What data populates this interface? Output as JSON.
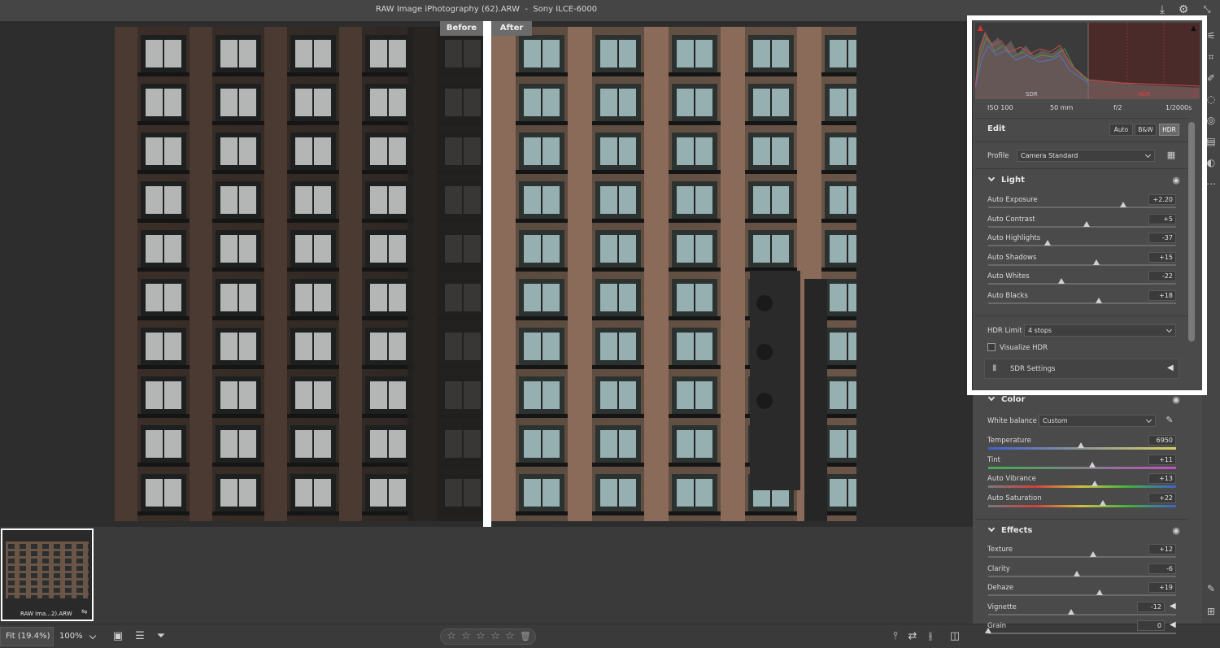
{
  "window": {
    "title": "RAW Image iPhotography (62).ARW  -  Sony ILCE-6000"
  },
  "canvas": {
    "before_label": "Before",
    "after_label": "After"
  },
  "filmstrip": {
    "thumb_label": "RAW Ima...2).ARW"
  },
  "bottom": {
    "fit_label": "Fit (19.4%)",
    "zoom_label": "100%",
    "rating_stars": 0
  },
  "histogram": {
    "sdr_label": "SDR",
    "hdr_label": "HDR"
  },
  "exif": {
    "iso": "ISO 100",
    "focal": "50 mm",
    "aperture": "f/2",
    "shutter": "1/2000s"
  },
  "edit": {
    "title": "Edit",
    "auto_btn": "Auto",
    "bw_btn": "B&W",
    "hdr_btn": "HDR",
    "profile_label": "Profile",
    "profile_value": "Camera Standard"
  },
  "light": {
    "title": "Light",
    "sliders": [
      {
        "label": "Auto Exposure",
        "value": "+2.20",
        "pos": 0.72
      },
      {
        "label": "Auto Contrast",
        "value": "+5",
        "pos": 0.525
      },
      {
        "label": "Auto Highlights",
        "value": "-37",
        "pos": 0.315
      },
      {
        "label": "Auto Shadows",
        "value": "+15",
        "pos": 0.575
      },
      {
        "label": "Auto Whites",
        "value": "-22",
        "pos": 0.39
      },
      {
        "label": "Auto Blacks",
        "value": "+18",
        "pos": 0.59
      }
    ],
    "hdr_limit_label": "HDR Limit",
    "hdr_limit_value": "4 stops",
    "visualize_hdr_label": "Visualize HDR",
    "sdr_settings_label": "SDR Settings"
  },
  "color": {
    "title": "Color",
    "wb_label": "White balance",
    "wb_value": "Custom",
    "sliders": [
      {
        "label": "Temperature",
        "value": "6950",
        "pos": 0.495
      },
      {
        "label": "Tint",
        "value": "+11",
        "pos": 0.555
      },
      {
        "label": "Auto Vibrance",
        "value": "+13",
        "pos": 0.565
      },
      {
        "label": "Auto Saturation",
        "value": "+22",
        "pos": 0.61
      }
    ]
  },
  "effects": {
    "title": "Effects",
    "sliders": [
      {
        "label": "Texture",
        "value": "+12",
        "pos": 0.56
      },
      {
        "label": "Clarity",
        "value": "-6",
        "pos": 0.47
      },
      {
        "label": "Dehaze",
        "value": "+19",
        "pos": 0.595
      },
      {
        "label": "Vignette",
        "value": "-12",
        "pos": 0.44
      },
      {
        "label": "Grain",
        "value": "0",
        "pos": 0.0
      }
    ]
  },
  "icons": {
    "download": "download-icon",
    "settings": "gear-icon",
    "collapse": "collapse-icon"
  }
}
